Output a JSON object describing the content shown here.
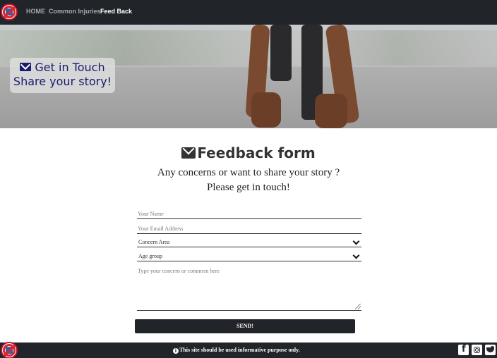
{
  "nav": {
    "links": [
      {
        "label": "HOME"
      },
      {
        "label": "Common Injuries"
      },
      {
        "label": "Feed Back"
      }
    ]
  },
  "hero": {
    "line1": "Get in Touch",
    "line2": "Share your story!"
  },
  "form": {
    "title": "Feedback form",
    "subtitle1": "Any concerns or want to share your story ?",
    "subtitle2": "Please get in touch!",
    "name_placeholder": "Your Name",
    "email_placeholder": "Your Email Address",
    "concern_value": "Concern Area",
    "age_value": "Age group",
    "comment_placeholder": "Type your concern or comment here",
    "send_label": "SEND!"
  },
  "footer": {
    "note": "This site should be used informative purpose only.",
    "info_glyph": "i",
    "fb_glyph": "f"
  },
  "colors": {
    "navbar": "#212529",
    "hero_text": "#1a1a6e",
    "brand_red": "#d62828",
    "brand_blue": "#2f5fb3"
  },
  "icons": [
    "logo-icon",
    "envelope-icon",
    "chevron-down-icon",
    "info-icon",
    "facebook-icon",
    "instagram-icon",
    "twitter-icon"
  ]
}
